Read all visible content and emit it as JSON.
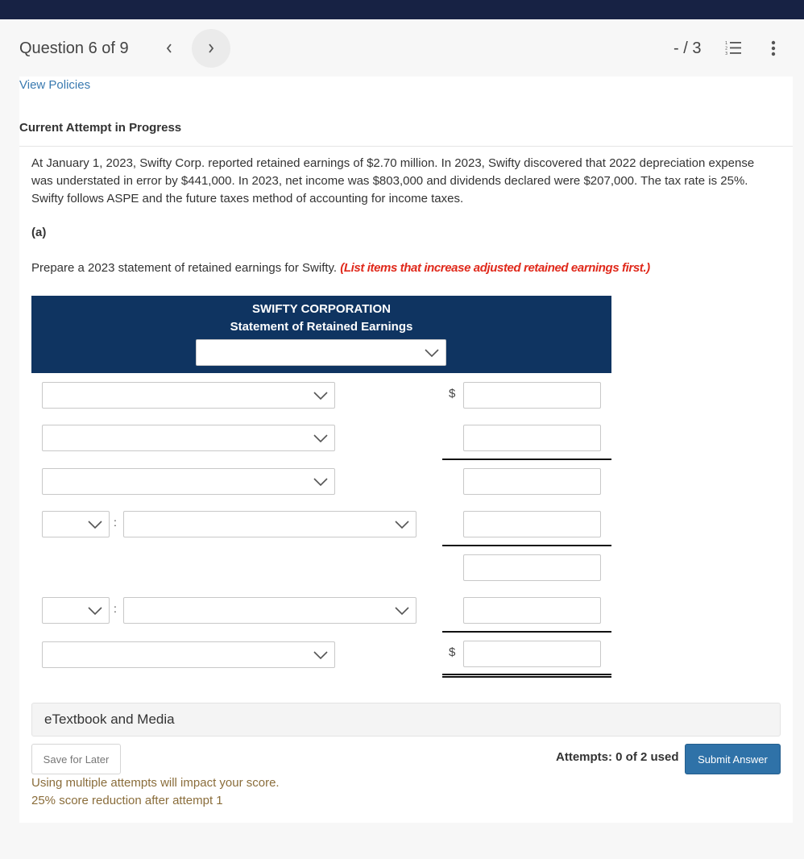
{
  "header": {
    "question_label": "Question 6 of 9",
    "prev_icon": "chevron-left-icon",
    "next_icon": "chevron-right-icon",
    "score": "- / 3",
    "list_icon": "numbered-list-icon",
    "more_icon": "more-vertical-icon"
  },
  "links": {
    "view_policies": "View Policies"
  },
  "attempt": {
    "title": "Current Attempt in Progress"
  },
  "problem": {
    "text": "At January 1, 2023, Swifty Corp. reported retained earnings of $2.70 million. In 2023, Swifty discovered that 2022 depreciation expense was understated in error by $441,000. In 2023, net income was $803,000 and dividends declared were $207,000. The tax rate is 25%. Swifty follows ASPE and the future taxes method of accounting for income taxes.",
    "part": "(a)",
    "instruction": "Prepare a 2023 statement of retained earnings for Swifty. ",
    "hint": "(List items that increase adjusted retained earnings first.)"
  },
  "statement": {
    "company": "SWIFTY CORPORATION",
    "title": "Statement of Retained Earnings",
    "period_select": {
      "value": "",
      "icon": "chevron-down-icon"
    },
    "currency_symbol": "$",
    "colon": ":",
    "rows": [
      {
        "type": "item",
        "select_value": "",
        "amount": "",
        "dollar": true
      },
      {
        "type": "item",
        "select_value": "",
        "amount": "",
        "dollar": false
      },
      {
        "type": "item",
        "select_value": "",
        "amount": "",
        "dollar": false
      },
      {
        "type": "prefixed",
        "prefix_value": "",
        "select_value": "",
        "amount": "",
        "dollar": false
      },
      {
        "type": "amount-only",
        "amount": ""
      },
      {
        "type": "prefixed",
        "prefix_value": "",
        "select_value": "",
        "amount": "",
        "dollar": false
      },
      {
        "type": "item",
        "select_value": "",
        "amount": "",
        "dollar": true
      }
    ]
  },
  "footer": {
    "etextbook": "eTextbook and Media",
    "save_label": "Save for Later",
    "attempts": "Attempts: 0 of 2 used",
    "submit_label": "Submit Answer",
    "warning_1": "Using multiple attempts will impact your score.",
    "warning_2": "25% score reduction after attempt 1"
  }
}
